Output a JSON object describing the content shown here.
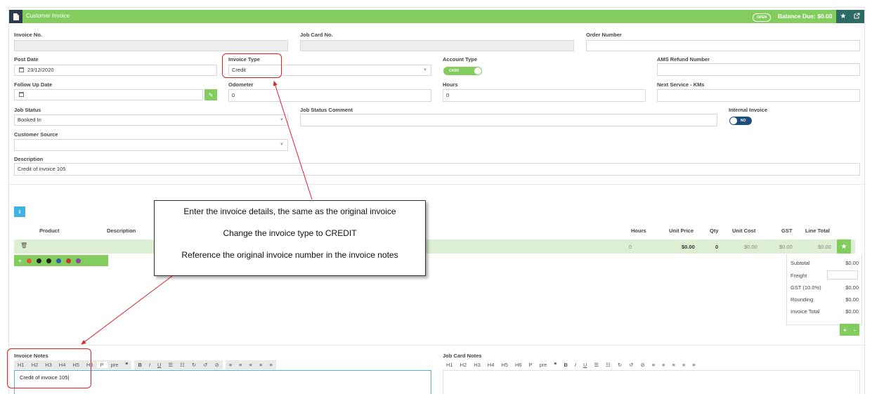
{
  "header": {
    "title": "Customer Invoice",
    "status": "OPEN",
    "balance": "Balance Due: $0.00"
  },
  "form": {
    "invoice_no": {
      "label": "Invoice No.",
      "value": ""
    },
    "job_card_no": {
      "label": "Job Card No.",
      "value": ""
    },
    "order_number": {
      "label": "Order Number",
      "value": ""
    },
    "post_date": {
      "label": "Post Date",
      "value": "23/12/2020"
    },
    "invoice_type": {
      "label": "Invoice Type",
      "value": "Credit"
    },
    "account_type": {
      "label": "Account Type",
      "value": "CASH"
    },
    "ams_refund": {
      "label": "AMS Refund Number",
      "value": ""
    },
    "follow_up": {
      "label": "Follow Up Date",
      "value": ""
    },
    "odometer": {
      "label": "Odometer",
      "value": "0"
    },
    "hours": {
      "label": "Hours",
      "value": "0"
    },
    "next_service": {
      "label": "Next Service - KMs",
      "value": ""
    },
    "job_status": {
      "label": "Job Status",
      "value": "Booked In"
    },
    "job_status_comment": {
      "label": "Job Status Comment",
      "value": ""
    },
    "internal_invoice": {
      "label": "Internal Invoice",
      "value": "NO"
    },
    "customer_source": {
      "label": "Customer Source",
      "value": ""
    },
    "description": {
      "label": "Description",
      "value": "Credit of invoice 105"
    }
  },
  "table": {
    "headers": [
      "Product",
      "Description",
      "Hours",
      "Unit Price",
      "Qty",
      "Unit Cost",
      "GST",
      "Line Total"
    ],
    "row": {
      "hours": "0",
      "unit_price": "$0.00",
      "qty": "0",
      "unit_cost": "$0.00",
      "gst": "$0.00",
      "line_total": "$0.00"
    }
  },
  "totals": {
    "subtotal": {
      "label": "Subtotal",
      "value": "$0.00"
    },
    "freight": {
      "label": "Freight",
      "value": ""
    },
    "gst": {
      "label": "GST (10.0%)",
      "value": "$0.00"
    },
    "rounding": {
      "label": "Rounding",
      "value": "$0.00"
    },
    "invoice_total": {
      "label": "Invoice Total",
      "value": "$0.00"
    }
  },
  "notes": {
    "invoice_label": "Invoice Notes",
    "job_card_label": "Job Card Notes",
    "toolbar": {
      "headings": [
        "H1",
        "H2",
        "H3",
        "H4",
        "H5",
        "H6",
        "P",
        "pre",
        "❞"
      ],
      "format": [
        "B",
        "I",
        "U",
        "☰",
        "☷",
        "↻",
        "↺",
        "⊘"
      ],
      "align": [
        "≡",
        "≡",
        "≡",
        "≡",
        "≡"
      ]
    },
    "invoice_text": "Credit of invoice 105"
  },
  "callout": {
    "line1": "Enter the invoice details, the same as the original invoice",
    "line2": "Change the invoice type to CREDIT",
    "line3": "Reference the original invoice  number  in the invoice notes"
  },
  "colors": {
    "header_green": "#82cd5d",
    "annotation_red": "#d9232a",
    "toggle_navy": "#1f4e79"
  }
}
